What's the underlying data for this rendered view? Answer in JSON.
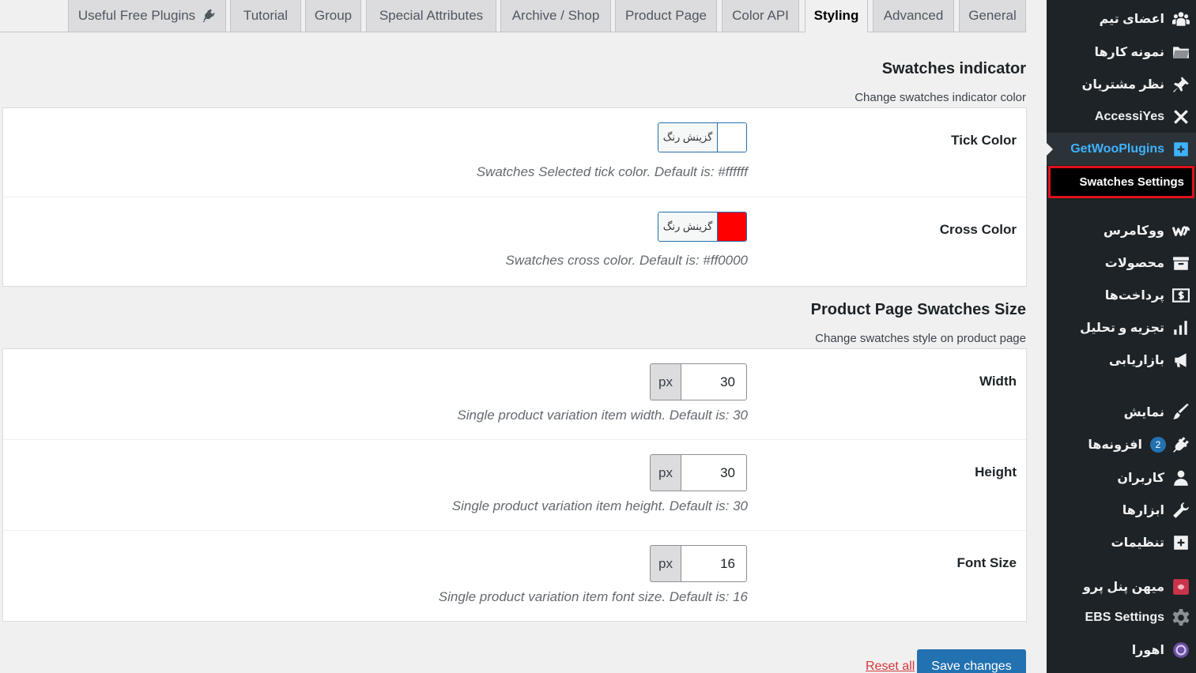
{
  "tabs": [
    {
      "label": "Useful Free Plugins",
      "active": false
    },
    {
      "label": "Tutorial",
      "active": false
    },
    {
      "label": "Group",
      "active": false
    },
    {
      "label": "Special Attributes",
      "active": false
    },
    {
      "label": "Archive / Shop",
      "active": false
    },
    {
      "label": "Product Page",
      "active": false
    },
    {
      "label": "Color API",
      "active": false
    },
    {
      "label": "Styling",
      "active": true
    },
    {
      "label": "Advanced",
      "active": false
    },
    {
      "label": "General",
      "active": false
    }
  ],
  "indicator": {
    "title": "Swatches indicator",
    "description": "Change swatches indicator color",
    "tick": {
      "label": "Tick Color",
      "button_text": "گزینش رنگ",
      "color": "#ffffff",
      "help": "Swatches Selected tick color. Default is: #ffffff"
    },
    "cross": {
      "label": "Cross Color",
      "button_text": "گزینش رنگ",
      "color": "#ff0000",
      "help": "Swatches cross color. Default is: #ff0000"
    }
  },
  "size": {
    "title": "Product Page Swatches Size",
    "description": "Change swatches style on product page",
    "width": {
      "label": "Width",
      "unit": "px",
      "value": "30",
      "help": "Single product variation item width. Default is: 30"
    },
    "height": {
      "label": "Height",
      "unit": "px",
      "value": "30",
      "help": "Single product variation item height. Default is: 30"
    },
    "font_size": {
      "label": "Font Size",
      "unit": "px",
      "value": "16",
      "help": "Single product variation item font size. Default is: 16"
    }
  },
  "actions": {
    "reset": "Reset all",
    "save": "Save changes"
  },
  "sidebar": {
    "items": [
      {
        "label": "اعضای تیم",
        "icon": "team-icon"
      },
      {
        "label": "نمونه کارها",
        "icon": "folder-icon"
      },
      {
        "label": "نظر مشتریان",
        "icon": "pin-icon"
      },
      {
        "label": "AccessiYes",
        "icon": "accessibility-icon"
      },
      {
        "label": "GetWooPlugins",
        "icon": "plugin-box-icon"
      },
      {
        "label": "ووکامرس",
        "icon": "woocommerce-icon"
      },
      {
        "label": "محصولات",
        "icon": "archive-icon"
      },
      {
        "label": "پرداخت‌ها",
        "icon": "dollar-icon"
      },
      {
        "label": "تجزیه و تحلیل",
        "icon": "bar-chart-icon"
      },
      {
        "label": "بازاریابی",
        "icon": "megaphone-icon"
      },
      {
        "label": "نمایش",
        "icon": "brush-icon"
      },
      {
        "label": "افزونه‌ها",
        "icon": "plugin-icon",
        "badge": "2"
      },
      {
        "label": "کاربران",
        "icon": "user-icon"
      },
      {
        "label": "ابزارها",
        "icon": "wrench-icon"
      },
      {
        "label": "تنظیمات",
        "icon": "settings-box-icon"
      },
      {
        "label": "میهن پنل پرو",
        "icon": "mihan-icon"
      },
      {
        "label": "EBS Settings",
        "icon": "gear-icon"
      },
      {
        "label": "اهورا",
        "icon": "ahura-icon"
      }
    ],
    "submenu": {
      "label": "Swatches Settings"
    }
  }
}
